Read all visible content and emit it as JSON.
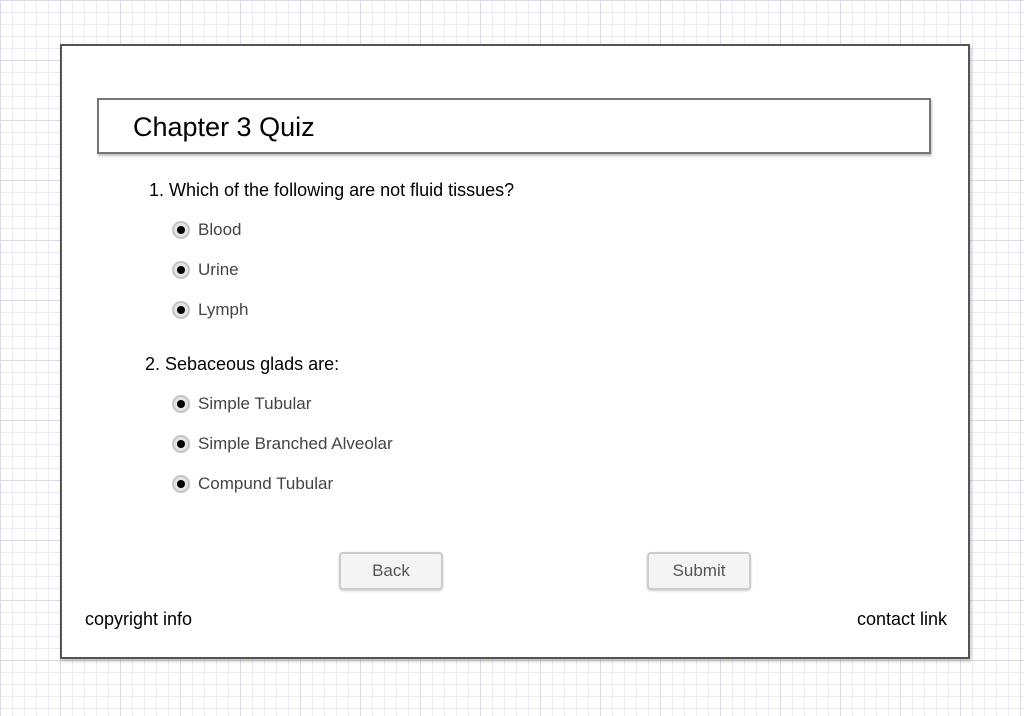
{
  "quiz": {
    "title": "Chapter 3 Quiz",
    "questions": [
      {
        "text": "1. Which of the following are not fluid tissues?",
        "options": [
          "Blood",
          "Urine",
          "Lymph"
        ]
      },
      {
        "text": "2. Sebaceous glads are:",
        "options": [
          "Simple Tubular",
          "Simple Branched Alveolar",
          "Compund Tubular"
        ]
      }
    ]
  },
  "buttons": {
    "back_label": "Back",
    "submit_label": "Submit"
  },
  "footer": {
    "copyright_text": "copyright info",
    "contact_text": "contact link"
  }
}
